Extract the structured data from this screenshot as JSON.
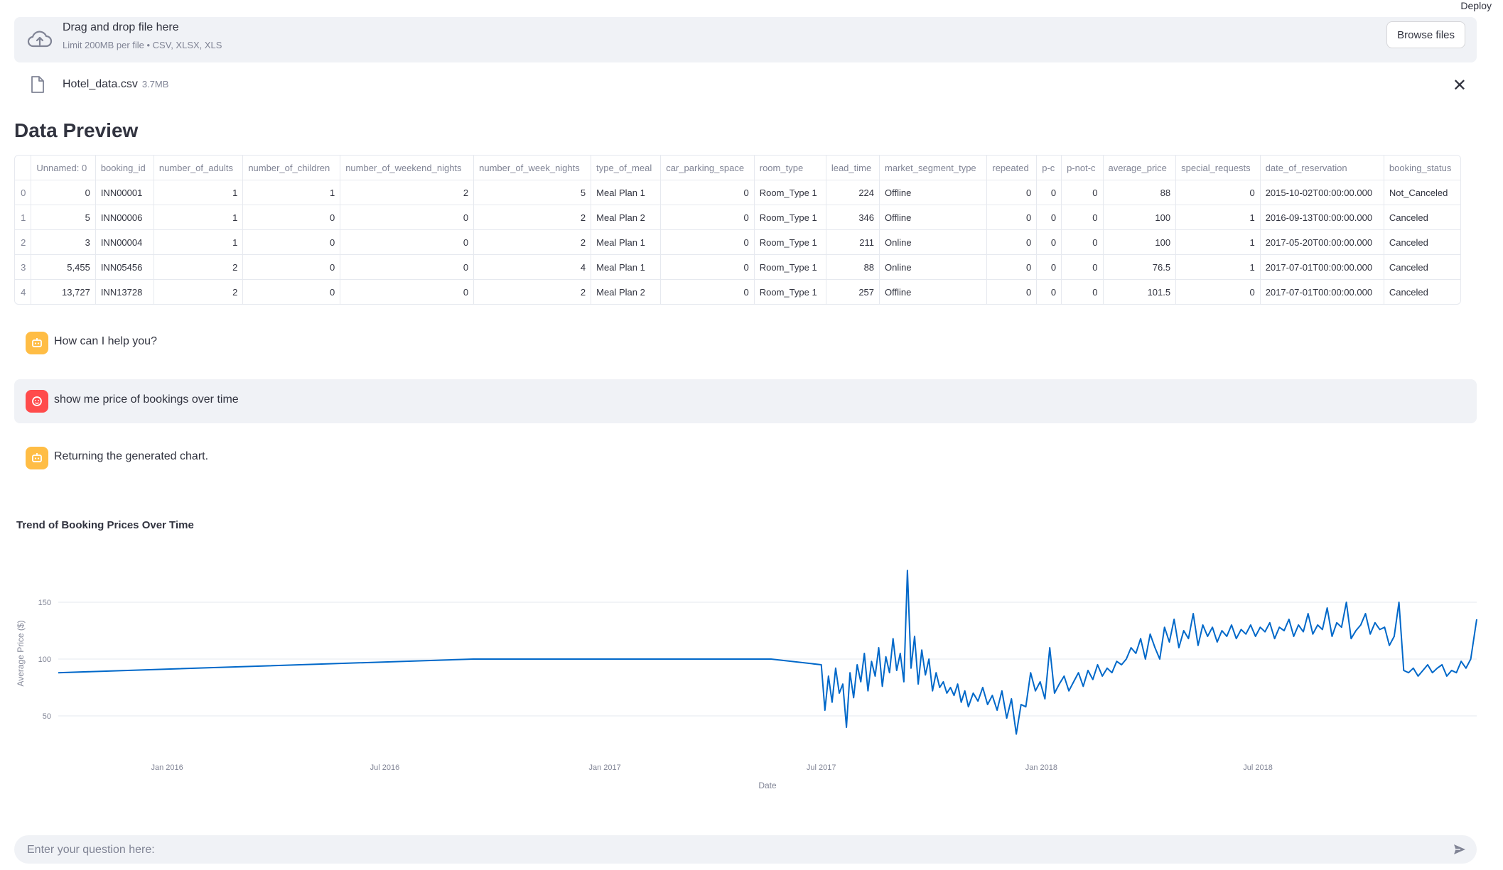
{
  "header": {
    "deploy_label": "Deploy"
  },
  "uploader": {
    "title": "Drag and drop file here",
    "subtitle": "Limit 200MB per file • CSV, XLSX, XLS",
    "browse_label": "Browse files"
  },
  "file": {
    "name": "Hotel_data.csv",
    "size": "3.7MB"
  },
  "preview": {
    "title": "Data Preview",
    "columns": [
      "",
      "Unnamed: 0",
      "booking_id",
      "number_of_adults",
      "number_of_children",
      "number_of_weekend_nights",
      "number_of_week_nights",
      "type_of_meal",
      "car_parking_space",
      "room_type",
      "lead_time",
      "market_segment_type",
      "repeated",
      "p-c",
      "p-not-c",
      "average_price",
      "special_requests",
      "date_of_reservation",
      "booking_status"
    ],
    "rows": [
      [
        "0",
        "0",
        "INN00001",
        "1",
        "1",
        "2",
        "5",
        "Meal Plan 1",
        "0",
        "Room_Type 1",
        "224",
        "Offline",
        "0",
        "0",
        "0",
        "88",
        "0",
        "2015-10-02T00:00:00.000",
        "Not_Canceled"
      ],
      [
        "1",
        "5",
        "INN00006",
        "1",
        "0",
        "0",
        "2",
        "Meal Plan 2",
        "0",
        "Room_Type 1",
        "346",
        "Offline",
        "0",
        "0",
        "0",
        "100",
        "1",
        "2016-09-13T00:00:00.000",
        "Canceled"
      ],
      [
        "2",
        "3",
        "INN00004",
        "1",
        "0",
        "0",
        "2",
        "Meal Plan 1",
        "0",
        "Room_Type 1",
        "211",
        "Online",
        "0",
        "0",
        "0",
        "100",
        "1",
        "2017-05-20T00:00:00.000",
        "Canceled"
      ],
      [
        "3",
        "5,455",
        "INN05456",
        "2",
        "0",
        "0",
        "4",
        "Meal Plan 1",
        "0",
        "Room_Type 1",
        "88",
        "Online",
        "0",
        "0",
        "0",
        "76.5",
        "1",
        "2017-07-01T00:00:00.000",
        "Canceled"
      ],
      [
        "4",
        "13,727",
        "INN13728",
        "2",
        "0",
        "0",
        "2",
        "Meal Plan 2",
        "0",
        "Room_Type 1",
        "257",
        "Offline",
        "0",
        "0",
        "0",
        "101.5",
        "0",
        "2017-07-01T00:00:00.000",
        "Canceled"
      ]
    ]
  },
  "chat": {
    "messages": [
      {
        "role": "assistant",
        "text": "How can I help you?"
      },
      {
        "role": "user",
        "text": "show me price of bookings over time"
      },
      {
        "role": "assistant",
        "text": "Returning the generated chart."
      }
    ]
  },
  "chart_data": {
    "type": "line",
    "title": "Trend of Booking Prices Over Time",
    "xlabel": "Date",
    "ylabel": "Average Price ($)",
    "x_ticks": [
      "Jan 2016",
      "Jul 2016",
      "Jan 2017",
      "Jul 2017",
      "Jan 2018",
      "Jul 2018"
    ],
    "y_ticks": [
      50,
      100,
      150
    ],
    "ylim": [
      30,
      180
    ],
    "grid": true,
    "color": "#0068c9",
    "series": [
      {
        "x": [
          "2015-10-02",
          "2016-09-13",
          "2017-05-20",
          "2017-07-01",
          "2017-07-04",
          "2017-07-07",
          "2017-07-10",
          "2017-07-13",
          "2017-07-16",
          "2017-07-19",
          "2017-07-22",
          "2017-07-25",
          "2017-07-28",
          "2017-07-31",
          "2017-08-03",
          "2017-08-06",
          "2017-08-09",
          "2017-08-12",
          "2017-08-15",
          "2017-08-18",
          "2017-08-21",
          "2017-08-24",
          "2017-08-27",
          "2017-08-30",
          "2017-09-02",
          "2017-09-05",
          "2017-09-08",
          "2017-09-11",
          "2017-09-14",
          "2017-09-17",
          "2017-09-20",
          "2017-09-23",
          "2017-09-26",
          "2017-09-29",
          "2017-10-02",
          "2017-10-05",
          "2017-10-08",
          "2017-10-11",
          "2017-10-14",
          "2017-10-17",
          "2017-10-20",
          "2017-10-23",
          "2017-10-26",
          "2017-10-29",
          "2017-11-01",
          "2017-11-05",
          "2017-11-09",
          "2017-11-13",
          "2017-11-17",
          "2017-11-21",
          "2017-11-25",
          "2017-11-29",
          "2017-12-03",
          "2017-12-07",
          "2017-12-11",
          "2017-12-15",
          "2017-12-19",
          "2017-12-23",
          "2017-12-27",
          "2017-12-31",
          "2018-01-04",
          "2018-01-08",
          "2018-01-12",
          "2018-01-16",
          "2018-01-20",
          "2018-01-24",
          "2018-01-28",
          "2018-02-01",
          "2018-02-05",
          "2018-02-09",
          "2018-02-13",
          "2018-02-17",
          "2018-02-21",
          "2018-02-25",
          "2018-03-01",
          "2018-03-05",
          "2018-03-09",
          "2018-03-13",
          "2018-03-17",
          "2018-03-21",
          "2018-03-25",
          "2018-03-29",
          "2018-04-02",
          "2018-04-06",
          "2018-04-10",
          "2018-04-14",
          "2018-04-18",
          "2018-04-22",
          "2018-04-26",
          "2018-04-30",
          "2018-05-04",
          "2018-05-08",
          "2018-05-12",
          "2018-05-16",
          "2018-05-20",
          "2018-05-24",
          "2018-05-28",
          "2018-06-01",
          "2018-06-05",
          "2018-06-09",
          "2018-06-13",
          "2018-06-17",
          "2018-06-21",
          "2018-06-25",
          "2018-06-29",
          "2018-07-03",
          "2018-07-07",
          "2018-07-11",
          "2018-07-15",
          "2018-07-19",
          "2018-07-23",
          "2018-07-27",
          "2018-07-31",
          "2018-08-04",
          "2018-08-08",
          "2018-08-12",
          "2018-08-16",
          "2018-08-20",
          "2018-08-24",
          "2018-08-28",
          "2018-09-01",
          "2018-09-05",
          "2018-09-09",
          "2018-09-13",
          "2018-09-17",
          "2018-09-21",
          "2018-09-25",
          "2018-09-29",
          "2018-10-03",
          "2018-10-07",
          "2018-10-11",
          "2018-10-15",
          "2018-10-19",
          "2018-10-23",
          "2018-10-27",
          "2018-10-31",
          "2018-11-04",
          "2018-11-08",
          "2018-11-12",
          "2018-11-16",
          "2018-11-20",
          "2018-11-24",
          "2018-11-28",
          "2018-12-02",
          "2018-12-06",
          "2018-12-10",
          "2018-12-14",
          "2018-12-18",
          "2018-12-22",
          "2018-12-26",
          "2018-12-31"
        ],
        "y": [
          88,
          100,
          100,
          95,
          55,
          85,
          62,
          92,
          70,
          78,
          40,
          88,
          66,
          95,
          80,
          105,
          72,
          98,
          85,
          110,
          76,
          102,
          88,
          118,
          90,
          105,
          80,
          178,
          92,
          120,
          78,
          108,
          86,
          100,
          72,
          88,
          75,
          80,
          70,
          75,
          68,
          78,
          62,
          72,
          58,
          70,
          63,
          75,
          60,
          68,
          55,
          72,
          48,
          65,
          34,
          60,
          58,
          88,
          72,
          80,
          65,
          110,
          70,
          78,
          85,
          72,
          80,
          88,
          76,
          90,
          82,
          95,
          85,
          92,
          88,
          98,
          95,
          100,
          110,
          105,
          118,
          100,
          122,
          110,
          100,
          128,
          115,
          135,
          110,
          125,
          118,
          140,
          112,
          130,
          120,
          128,
          115,
          125,
          120,
          130,
          118,
          126,
          122,
          130,
          120,
          128,
          124,
          132,
          118,
          128,
          125,
          135,
          120,
          130,
          124,
          140,
          122,
          130,
          126,
          145,
          120,
          132,
          128,
          150,
          118,
          125,
          130,
          140,
          122,
          132,
          126,
          128,
          112,
          120,
          150,
          90,
          88,
          92,
          85,
          90,
          95,
          88,
          92,
          95,
          85,
          90,
          88,
          98,
          92,
          100,
          135
        ]
      }
    ]
  },
  "input": {
    "placeholder": "Enter your question here:"
  }
}
